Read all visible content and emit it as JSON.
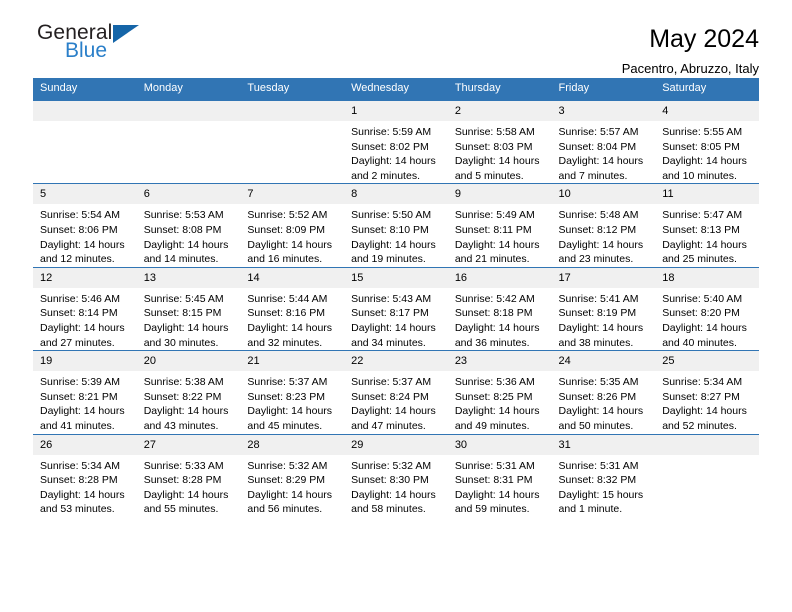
{
  "logo": {
    "word1": "General",
    "word2": "Blue",
    "triangle_color": "#1565a8",
    "blue_text_color": "#2a7fc9"
  },
  "header": {
    "title": "May 2024",
    "subtitle": "Pacentro, Abruzzo, Italy"
  },
  "theme": {
    "header_blue": "#3175b4",
    "daynum_band": "#f0f0f0"
  },
  "weekday_headers": [
    "Sunday",
    "Monday",
    "Tuesday",
    "Wednesday",
    "Thursday",
    "Friday",
    "Saturday"
  ],
  "weeks": [
    [
      {
        "day": "",
        "lines": []
      },
      {
        "day": "",
        "lines": []
      },
      {
        "day": "",
        "lines": []
      },
      {
        "day": "1",
        "lines": [
          "Sunrise: 5:59 AM",
          "Sunset: 8:02 PM",
          "Daylight: 14 hours",
          "and 2 minutes."
        ]
      },
      {
        "day": "2",
        "lines": [
          "Sunrise: 5:58 AM",
          "Sunset: 8:03 PM",
          "Daylight: 14 hours",
          "and 5 minutes."
        ]
      },
      {
        "day": "3",
        "lines": [
          "Sunrise: 5:57 AM",
          "Sunset: 8:04 PM",
          "Daylight: 14 hours",
          "and 7 minutes."
        ]
      },
      {
        "day": "4",
        "lines": [
          "Sunrise: 5:55 AM",
          "Sunset: 8:05 PM",
          "Daylight: 14 hours",
          "and 10 minutes."
        ]
      }
    ],
    [
      {
        "day": "5",
        "lines": [
          "Sunrise: 5:54 AM",
          "Sunset: 8:06 PM",
          "Daylight: 14 hours",
          "and 12 minutes."
        ]
      },
      {
        "day": "6",
        "lines": [
          "Sunrise: 5:53 AM",
          "Sunset: 8:08 PM",
          "Daylight: 14 hours",
          "and 14 minutes."
        ]
      },
      {
        "day": "7",
        "lines": [
          "Sunrise: 5:52 AM",
          "Sunset: 8:09 PM",
          "Daylight: 14 hours",
          "and 16 minutes."
        ]
      },
      {
        "day": "8",
        "lines": [
          "Sunrise: 5:50 AM",
          "Sunset: 8:10 PM",
          "Daylight: 14 hours",
          "and 19 minutes."
        ]
      },
      {
        "day": "9",
        "lines": [
          "Sunrise: 5:49 AM",
          "Sunset: 8:11 PM",
          "Daylight: 14 hours",
          "and 21 minutes."
        ]
      },
      {
        "day": "10",
        "lines": [
          "Sunrise: 5:48 AM",
          "Sunset: 8:12 PM",
          "Daylight: 14 hours",
          "and 23 minutes."
        ]
      },
      {
        "day": "11",
        "lines": [
          "Sunrise: 5:47 AM",
          "Sunset: 8:13 PM",
          "Daylight: 14 hours",
          "and 25 minutes."
        ]
      }
    ],
    [
      {
        "day": "12",
        "lines": [
          "Sunrise: 5:46 AM",
          "Sunset: 8:14 PM",
          "Daylight: 14 hours",
          "and 27 minutes."
        ]
      },
      {
        "day": "13",
        "lines": [
          "Sunrise: 5:45 AM",
          "Sunset: 8:15 PM",
          "Daylight: 14 hours",
          "and 30 minutes."
        ]
      },
      {
        "day": "14",
        "lines": [
          "Sunrise: 5:44 AM",
          "Sunset: 8:16 PM",
          "Daylight: 14 hours",
          "and 32 minutes."
        ]
      },
      {
        "day": "15",
        "lines": [
          "Sunrise: 5:43 AM",
          "Sunset: 8:17 PM",
          "Daylight: 14 hours",
          "and 34 minutes."
        ]
      },
      {
        "day": "16",
        "lines": [
          "Sunrise: 5:42 AM",
          "Sunset: 8:18 PM",
          "Daylight: 14 hours",
          "and 36 minutes."
        ]
      },
      {
        "day": "17",
        "lines": [
          "Sunrise: 5:41 AM",
          "Sunset: 8:19 PM",
          "Daylight: 14 hours",
          "and 38 minutes."
        ]
      },
      {
        "day": "18",
        "lines": [
          "Sunrise: 5:40 AM",
          "Sunset: 8:20 PM",
          "Daylight: 14 hours",
          "and 40 minutes."
        ]
      }
    ],
    [
      {
        "day": "19",
        "lines": [
          "Sunrise: 5:39 AM",
          "Sunset: 8:21 PM",
          "Daylight: 14 hours",
          "and 41 minutes."
        ]
      },
      {
        "day": "20",
        "lines": [
          "Sunrise: 5:38 AM",
          "Sunset: 8:22 PM",
          "Daylight: 14 hours",
          "and 43 minutes."
        ]
      },
      {
        "day": "21",
        "lines": [
          "Sunrise: 5:37 AM",
          "Sunset: 8:23 PM",
          "Daylight: 14 hours",
          "and 45 minutes."
        ]
      },
      {
        "day": "22",
        "lines": [
          "Sunrise: 5:37 AM",
          "Sunset: 8:24 PM",
          "Daylight: 14 hours",
          "and 47 minutes."
        ]
      },
      {
        "day": "23",
        "lines": [
          "Sunrise: 5:36 AM",
          "Sunset: 8:25 PM",
          "Daylight: 14 hours",
          "and 49 minutes."
        ]
      },
      {
        "day": "24",
        "lines": [
          "Sunrise: 5:35 AM",
          "Sunset: 8:26 PM",
          "Daylight: 14 hours",
          "and 50 minutes."
        ]
      },
      {
        "day": "25",
        "lines": [
          "Sunrise: 5:34 AM",
          "Sunset: 8:27 PM",
          "Daylight: 14 hours",
          "and 52 minutes."
        ]
      }
    ],
    [
      {
        "day": "26",
        "lines": [
          "Sunrise: 5:34 AM",
          "Sunset: 8:28 PM",
          "Daylight: 14 hours",
          "and 53 minutes."
        ]
      },
      {
        "day": "27",
        "lines": [
          "Sunrise: 5:33 AM",
          "Sunset: 8:28 PM",
          "Daylight: 14 hours",
          "and 55 minutes."
        ]
      },
      {
        "day": "28",
        "lines": [
          "Sunrise: 5:32 AM",
          "Sunset: 8:29 PM",
          "Daylight: 14 hours",
          "and 56 minutes."
        ]
      },
      {
        "day": "29",
        "lines": [
          "Sunrise: 5:32 AM",
          "Sunset: 8:30 PM",
          "Daylight: 14 hours",
          "and 58 minutes."
        ]
      },
      {
        "day": "30",
        "lines": [
          "Sunrise: 5:31 AM",
          "Sunset: 8:31 PM",
          "Daylight: 14 hours",
          "and 59 minutes."
        ]
      },
      {
        "day": "31",
        "lines": [
          "Sunrise: 5:31 AM",
          "Sunset: 8:32 PM",
          "Daylight: 15 hours",
          "and 1 minute."
        ]
      },
      {
        "day": "",
        "lines": []
      }
    ]
  ]
}
